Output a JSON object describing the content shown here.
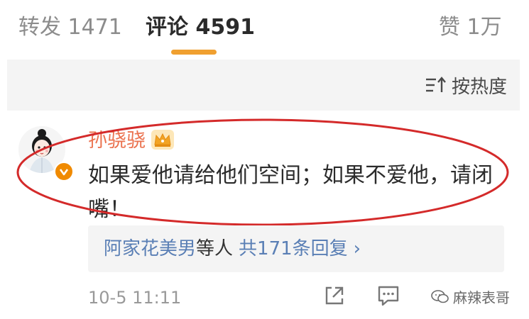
{
  "tabs": {
    "repost": "转发 1471",
    "comment": "评论 4591",
    "like": "赞 1万",
    "active_color": "#f0a030"
  },
  "sort": {
    "label": "按热度",
    "icon": "sort-icon"
  },
  "comment": {
    "username": "孙骁骁",
    "username_color": "#eb7350",
    "text": "如果爱他请给他们空间；如果不爱他，请闭嘴！",
    "badge_icon": "verified-icon",
    "crown_icon": "crown-icon",
    "replies": {
      "users": "阿家花美男",
      "suffix": "等人",
      "count": "共171条回复",
      "chevron": "›"
    },
    "timestamp": "10-5 11:11",
    "highlight_color": "#d42a2a"
  },
  "watermark": {
    "text": "麻辣表哥"
  }
}
